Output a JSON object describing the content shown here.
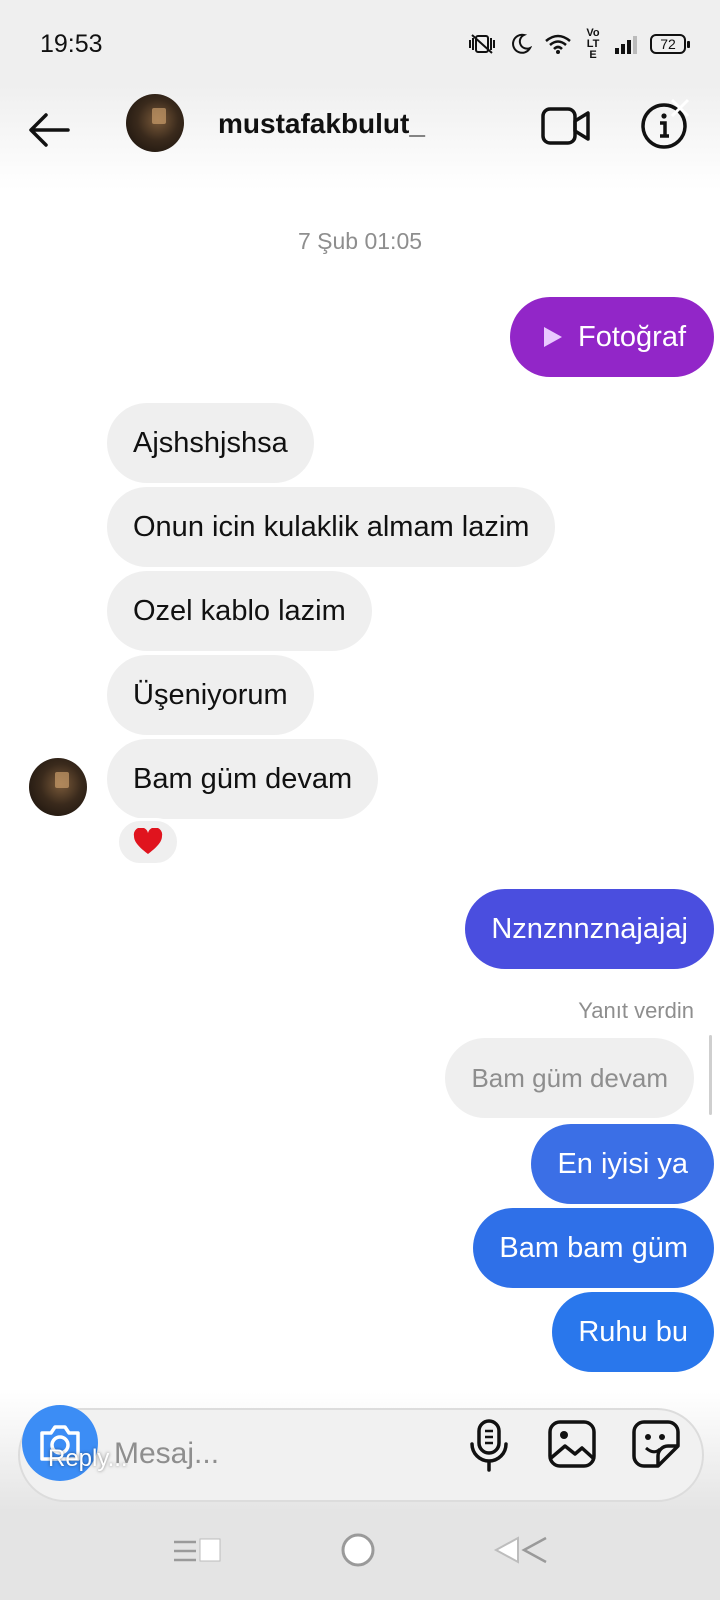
{
  "status_bar": {
    "time": "19:53",
    "battery": "72",
    "network_label": "Vo LTE"
  },
  "header": {
    "username": "mustafakbulut_"
  },
  "chat": {
    "timestamp": "7 Şub 01:05",
    "photo_message": "Fotoğraf",
    "received_messages": [
      "Ajshshjshsa",
      "Onun icin kulaklik almam lazim",
      "Ozel kablo lazim",
      "Üşeniyorum",
      "Bam güm devam"
    ],
    "reaction": "❤️",
    "sent_message_1": "Nznznnznajajaj",
    "reply_label": "Yanıt verdin",
    "reply_quote": "Bam güm devam",
    "sent_messages": [
      "En iyisi ya",
      "Bam bam güm",
      "Ruhu bu"
    ]
  },
  "composer": {
    "placeholder": "Mesaj...",
    "reply_overlay": "Reply..."
  },
  "colors": {
    "photo_bubble": "#9226c8",
    "gradient_purple_blue": "#4a4edf",
    "gradient_blue": "#3b6fe6",
    "gradient_blue_2": "#2f70e8",
    "gradient_blue_3": "#2977ec",
    "received_bubble": "#efefef",
    "camera_button": "#3c8df5"
  }
}
